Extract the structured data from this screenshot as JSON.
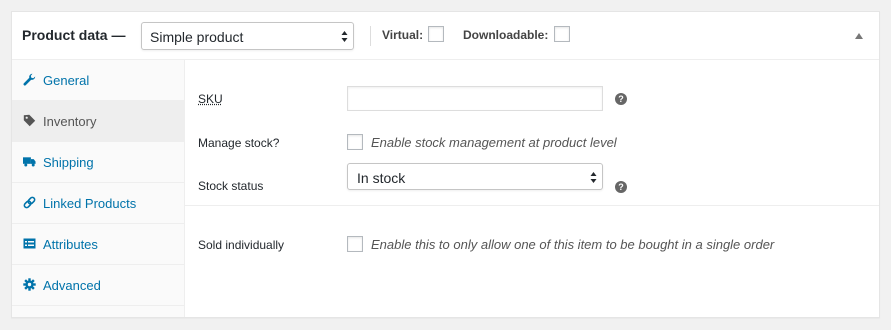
{
  "header": {
    "title": "Product data —",
    "product_type": {
      "selected": "Simple product"
    },
    "virtual_label": "Virtual:",
    "downloadable_label": "Downloadable:",
    "virtual_checked": false,
    "downloadable_checked": false
  },
  "tabs": [
    {
      "label": "General",
      "icon": "wrench-icon",
      "active": false
    },
    {
      "label": "Inventory",
      "icon": "tag-icon",
      "active": true
    },
    {
      "label": "Shipping",
      "icon": "truck-icon",
      "active": false
    },
    {
      "label": "Linked Products",
      "icon": "link-icon",
      "active": false
    },
    {
      "label": "Attributes",
      "icon": "list-icon",
      "active": false
    },
    {
      "label": "Advanced",
      "icon": "gear-icon",
      "active": false
    }
  ],
  "inventory": {
    "sku": {
      "label": "SKU",
      "value": ""
    },
    "manage_stock": {
      "label": "Manage stock?",
      "checked": false,
      "description": "Enable stock management at product level"
    },
    "stock_status": {
      "label": "Stock status",
      "selected": "In stock"
    },
    "sold_individually": {
      "label": "Sold individually",
      "checked": false,
      "description": "Enable this to only allow one of this item to be bought in a single order"
    },
    "help_glyph": "?"
  },
  "colors": {
    "link": "#0073aa",
    "active_tab_bg": "#eeeeee",
    "panel_bg": "#ffffff",
    "page_bg": "#f1f1f1"
  }
}
